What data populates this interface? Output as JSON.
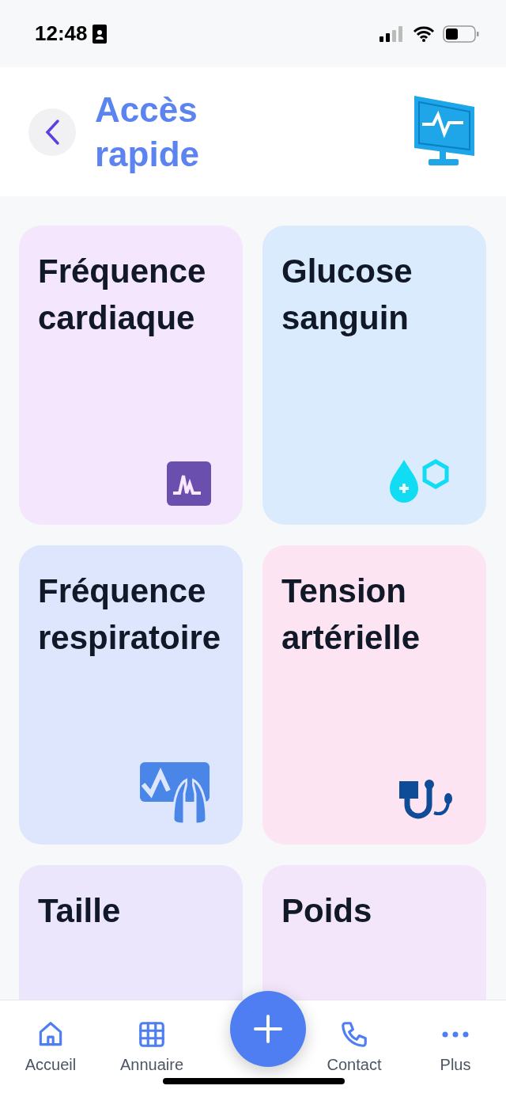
{
  "status_bar": {
    "time": "12:48"
  },
  "header": {
    "title": "Accès rapide"
  },
  "tiles": [
    {
      "label": "Fréquence cardiaque",
      "color": "#f3e6fd",
      "kind": "pulse"
    },
    {
      "label": "Glucose sanguin",
      "color": "#d9ebfd",
      "kind": "glucose"
    },
    {
      "label": "Fréquence respiratoire",
      "color": "#dde6fc",
      "kind": "lungs"
    },
    {
      "label": "Tension artérielle",
      "color": "#fde4f2",
      "kind": "pressure"
    },
    {
      "label": "Taille",
      "color": "#ebe6fb",
      "kind": "plain"
    },
    {
      "label": "Poids",
      "color": "#f3e6fb",
      "kind": "plain"
    }
  ],
  "tab_bar": {
    "items": [
      {
        "label": "Accueil",
        "kind": "home"
      },
      {
        "label": "Annuaire",
        "kind": "grid"
      },
      {
        "label": "Contact",
        "kind": "phone"
      },
      {
        "label": "Plus",
        "kind": "more"
      }
    ]
  }
}
